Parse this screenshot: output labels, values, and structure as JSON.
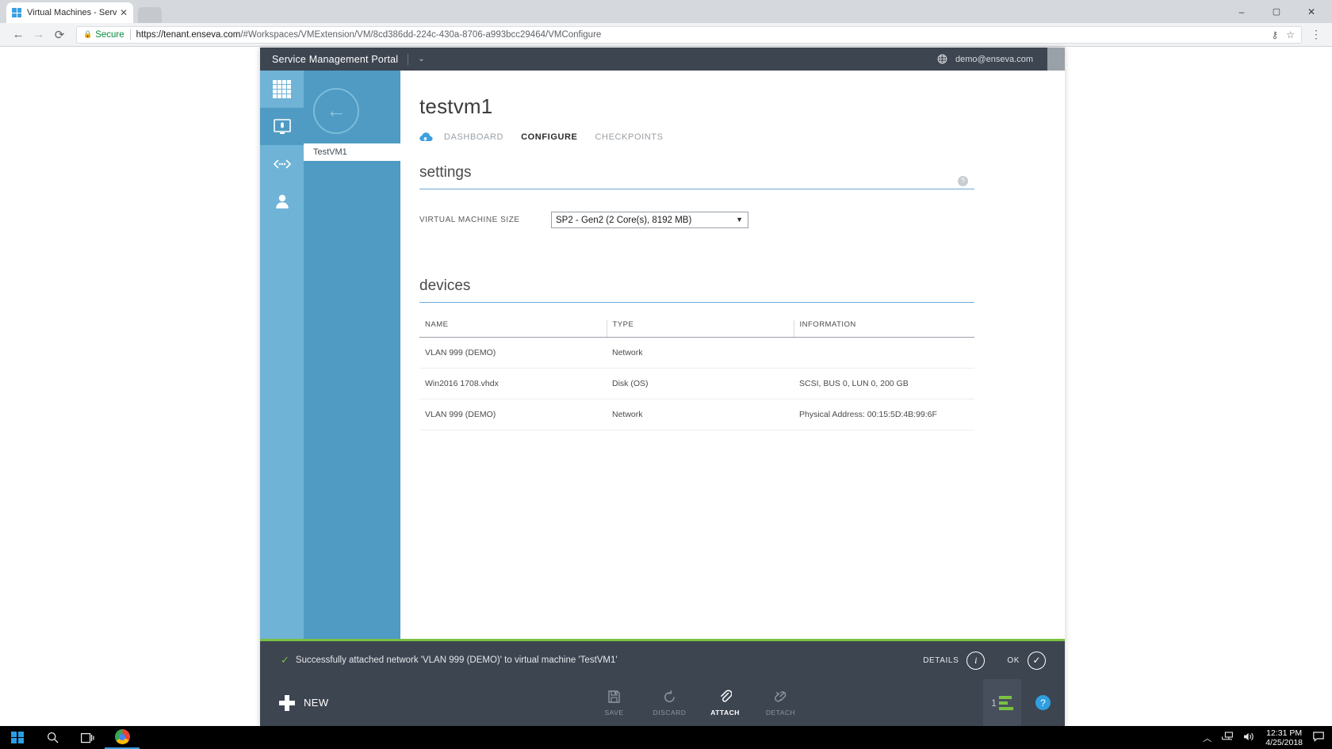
{
  "browser": {
    "tab": {
      "title": "Virtual Machines - Servic",
      "close_label": "✕",
      "favicon": "windows-logo-icon"
    },
    "new_tab_label": "",
    "nav": {
      "back": "←",
      "forward": "→",
      "reload": "⟳"
    },
    "omnibox": {
      "lock_icon": "lock-icon",
      "secure_label": "Secure",
      "url_host": "https://tenant.enseva.com",
      "url_rest": "/#Workspaces/VMExtension/VM/8cd386dd-224c-430a-8706-a993bcc29464/VMConfigure",
      "star_icon": "star-icon",
      "key_icon": "key-icon"
    },
    "menu_icon": "vertical-dots-icon",
    "profile_icon": "profile-icon",
    "window_controls": {
      "minimize": "–",
      "maximize": "▢",
      "close": "✕"
    }
  },
  "portal": {
    "brand": "Service Management Portal",
    "brand_caret": "⌄",
    "user_email": "demo@enseva.com",
    "globe_icon": "globe-icon",
    "avatar": "user-avatar",
    "rail": [
      {
        "name": "all-items",
        "icon": "grid-icon"
      },
      {
        "name": "virtual-machines",
        "icon": "monitor-icon",
        "active": true
      },
      {
        "name": "networks",
        "icon": "network-icon"
      },
      {
        "name": "user-accounts",
        "icon": "person-icon"
      }
    ],
    "back_arrow": "←",
    "subnav_item": "TestVM1",
    "page_title": "testvm1",
    "tabs": [
      {
        "label": "DASHBOARD",
        "active": false
      },
      {
        "label": "CONFIGURE",
        "active": true
      },
      {
        "label": "CHECKPOINTS",
        "active": false
      }
    ],
    "settings": {
      "heading": "settings",
      "help_glyph": "?",
      "vm_size_label": "VIRTUAL MACHINE SIZE",
      "vm_size_value": "SP2 - Gen2 (2 Core(s), 8192 MB)",
      "vm_size_options": [
        "SP2 - Gen2 (2 Core(s), 8192 MB)"
      ],
      "caret": "▼"
    },
    "devices": {
      "heading": "devices",
      "columns": [
        "NAME",
        "TYPE",
        "INFORMATION"
      ],
      "rows": [
        {
          "name": "VLAN 999 (DEMO)",
          "type": "Network",
          "information": ""
        },
        {
          "name": "Win2016 1708.vhdx",
          "type": "Disk (OS)",
          "information": "SCSI, BUS 0, LUN 0, 200 GB"
        },
        {
          "name": "VLAN 999 (DEMO)",
          "type": "Network",
          "information": "Physical Address: 00:15:5D:4B:99:6F"
        }
      ]
    },
    "notification": {
      "check_glyph": "✓",
      "message": "Successfully attached network 'VLAN 999 (DEMO)' to virtual machine 'TestVM1'",
      "details_label": "DETAILS",
      "details_glyph": "i",
      "ok_label": "OK",
      "ok_glyph": "✓"
    },
    "commandbar": {
      "new_label": "NEW",
      "items": [
        {
          "label": "SAVE",
          "icon": "save-icon",
          "state": "dim"
        },
        {
          "label": "DISCARD",
          "icon": "discard-icon",
          "state": "dim"
        },
        {
          "label": "ATTACH",
          "icon": "attach-icon",
          "state": "on"
        },
        {
          "label": "DETACH",
          "icon": "detach-icon",
          "state": "dim"
        }
      ],
      "log_count": "1",
      "help_glyph": "?"
    },
    "accent_color": "#7ac143",
    "rail_color": "#6fb3d6",
    "header_color": "#3d4551"
  },
  "taskbar": {
    "start_icon": "windows-start-icon",
    "search_icon": "search-icon",
    "taskview_icon": "task-view-icon",
    "chrome_icon": "chrome-icon",
    "tray": {
      "chevron": "︿",
      "network_icon": "network-tray-icon",
      "volume_icon": "volume-icon",
      "time": "12:31 PM",
      "date": "4/25/2018",
      "action_center_icon": "action-center-icon"
    }
  }
}
